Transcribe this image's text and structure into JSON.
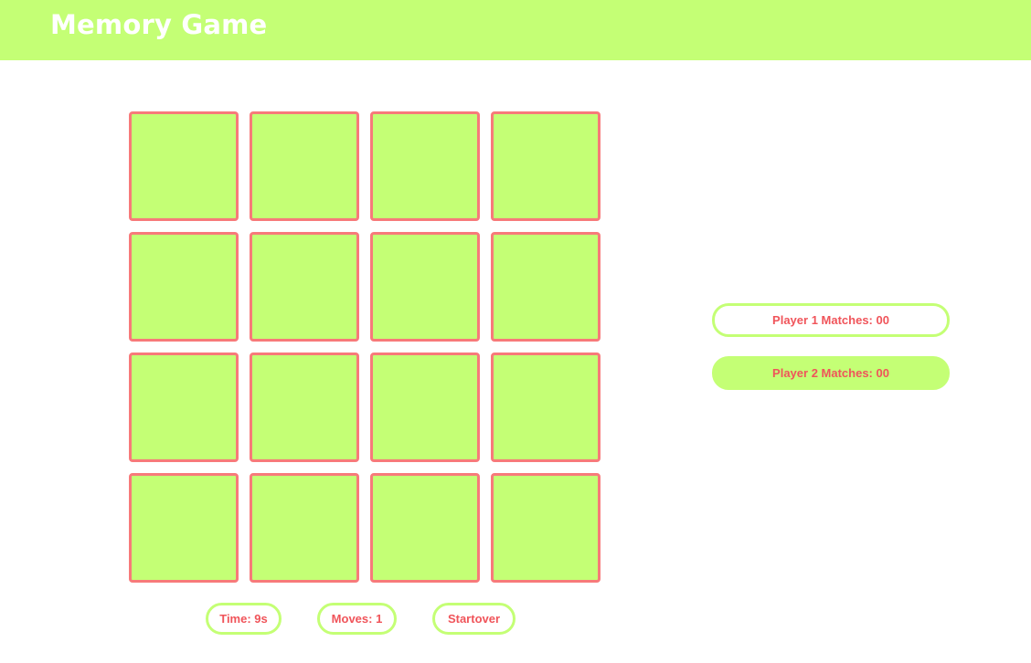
{
  "header": {
    "title": "Memory Game"
  },
  "board": {
    "rows": 4,
    "cols": 4,
    "card_state": "face-down"
  },
  "stats": {
    "time": "Time: 9s",
    "moves": "Moves: 1",
    "startover": "Startover"
  },
  "players": {
    "player1": "Player 1 Matches: 00",
    "player2": "Player 2 Matches: 00"
  },
  "colors": {
    "accent_green": "#c4ff75",
    "card_border": "#f77a7a",
    "text_red": "#f0545a",
    "background": "#ffffff"
  }
}
